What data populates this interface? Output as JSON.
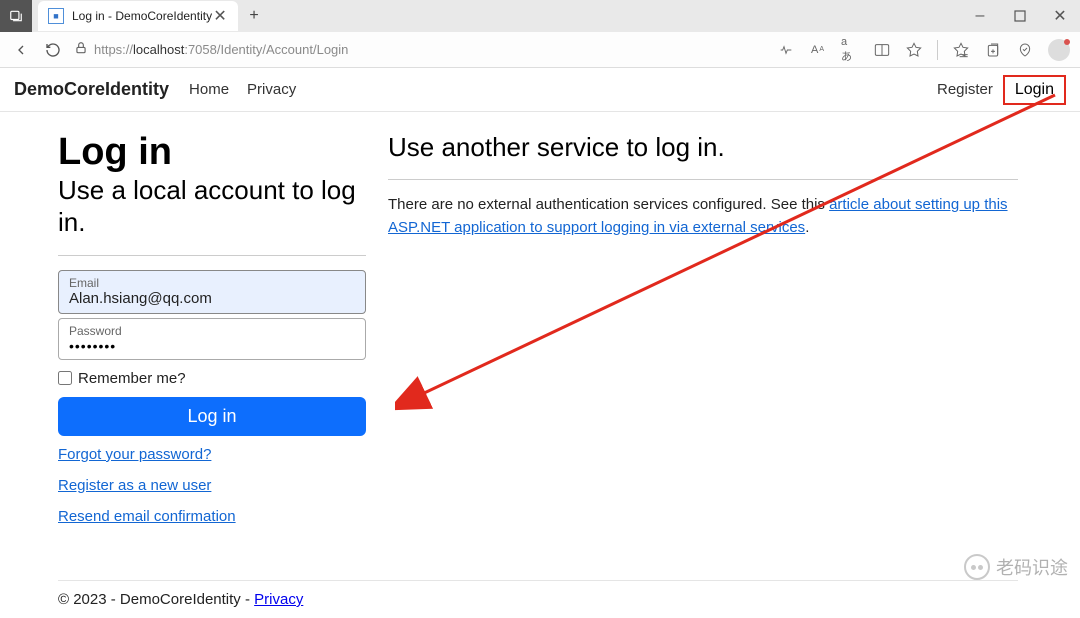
{
  "browser": {
    "tab_title": "Log in - DemoCoreIdentity",
    "url_proto": "https://",
    "url_host": "localhost",
    "url_rest": ":7058/Identity/Account/Login"
  },
  "navbar": {
    "brand": "DemoCoreIdentity",
    "home": "Home",
    "privacy": "Privacy",
    "register": "Register",
    "login": "Login"
  },
  "page": {
    "heading": "Log in",
    "local_heading": "Use a local account to log in.",
    "external_heading": "Use another service to log in.",
    "email_label": "Email",
    "email_value": "Alan.hsiang@qq.com",
    "password_label": "Password",
    "password_value": "••••••••",
    "remember": "Remember me?",
    "login_btn": "Log in",
    "forgot": "Forgot your password?",
    "register_new": "Register as a new user",
    "resend": "Resend email confirmation",
    "external_text_pre": "There are no external authentication services configured. See this ",
    "external_link": "article about setting up this ASP.NET application to support logging in via external services",
    "external_text_post": "."
  },
  "footer": {
    "text_pre": "© 2023 - DemoCoreIdentity - ",
    "privacy": "Privacy"
  },
  "watermark": {
    "text": "老码识途"
  }
}
